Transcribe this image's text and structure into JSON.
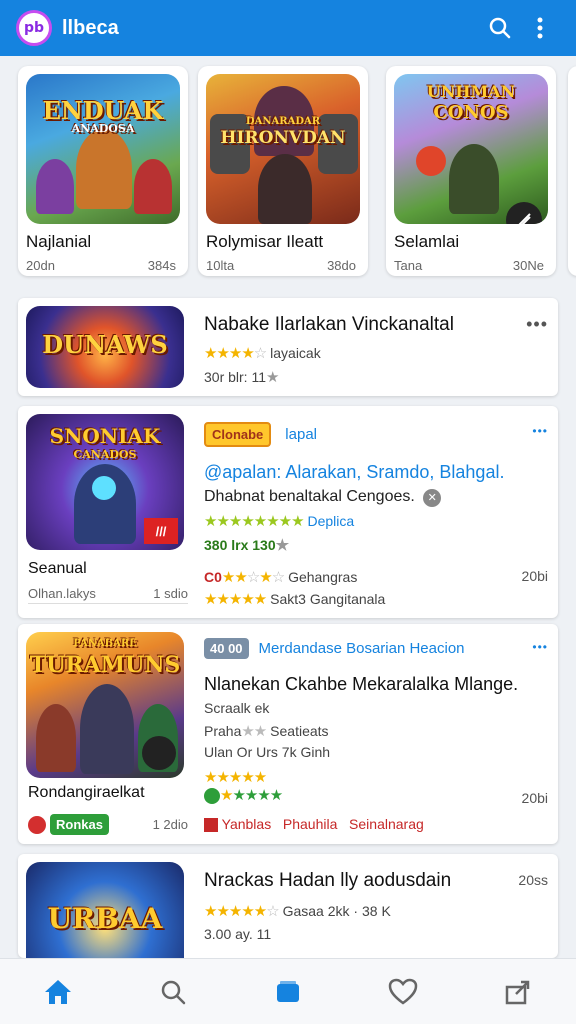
{
  "app": {
    "title": "llbeca",
    "logo_text": "pb"
  },
  "featured": [
    {
      "thumb_title": "ENDUAK",
      "thumb_sub": "ANADOSA",
      "name": "Najlanial",
      "left": "20dn",
      "right": "384s"
    },
    {
      "thumb_title": "HIRONVDAN",
      "thumb_sub": "DANARADAR",
      "name": "Rolymisar Ileatt",
      "left": "10lta",
      "right": "38do"
    },
    {
      "thumb_title": "UNHMAN",
      "thumb_sub": "CONOS",
      "name": "Selamlai",
      "left": "Tana",
      "right": "30Ne"
    }
  ],
  "list": [
    {
      "thumb_title": "DUNAWS",
      "title": "Nabake Ilarlakan Vinckanaltal",
      "rating_text": "layaicak",
      "meta": "30r blr: 11",
      "more": "•••"
    },
    {
      "thumb_title": "SNONIAK",
      "thumb_sub": "CANADOS",
      "caption": "Seanual",
      "caption_sub_left": "Olhan.lakys",
      "caption_sub_right": "1 sdio",
      "badge": "Clonabe",
      "tag": "lapal",
      "more": "•••",
      "desc1": "@apalan: Alarakan, Sramdo, Blahgal.",
      "desc2": "Dhabnat benaltakal Cengoes.",
      "rating_text": "Deplica",
      "meta": "380 lrx 130",
      "row1_text": "Gehangras",
      "row1_right": "20bi",
      "row1_prefix": "C0",
      "row2_text": "Sakt3 Gangitanala"
    },
    {
      "thumb_title": "TURAMUNS",
      "thumb_sub": "PANABARE",
      "caption": "Rondangiraelkat",
      "pill": "Ronkas",
      "caption_sub_right": "1 2dio",
      "badge": "40 00",
      "tag": "Merdandase Bosarian Heacion",
      "more": "•••",
      "desc1": "Nlanekan Ckahbe Mekaralalka Mlange.",
      "line1": "Scraalk ek",
      "line2": "Praha",
      "line2b": "Seatieats",
      "line3": "Ulan Or Urs 7k Ginh",
      "right_meta": "20bi",
      "tag1": "Yanblas",
      "tag2": "Phauhila",
      "tag3": "Seinalnarag"
    },
    {
      "thumb_title": "URBAA",
      "title": "Nrackas Hadan lly aodusdain",
      "right_meta": "20ss",
      "rating_text": "Gasaa 2kk",
      "rating_right": "38 K",
      "meta": "3.00 ay. 11"
    }
  ],
  "colors": {
    "appbar": "#1583df",
    "star": "#f4b400",
    "accent": "#1583df"
  }
}
